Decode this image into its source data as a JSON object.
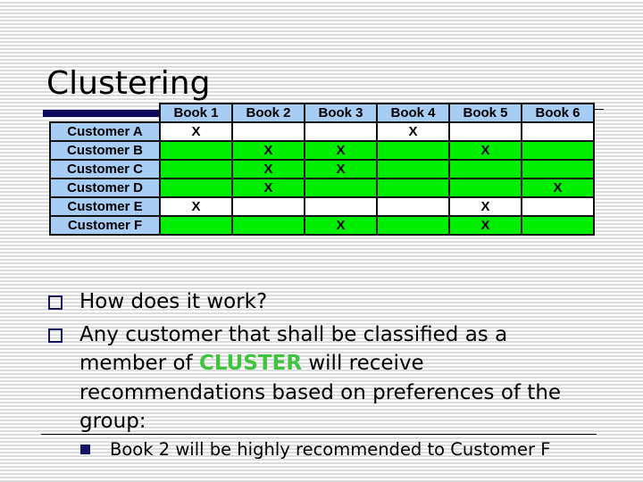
{
  "slide": {
    "title": "Clustering"
  },
  "table": {
    "columns": [
      "Book 1",
      "Book 2",
      "Book 3",
      "Book 4",
      "Book 5",
      "Book 6"
    ],
    "rows": [
      {
        "label": "Customer A",
        "cells": [
          "X",
          "",
          "",
          "X",
          "",
          ""
        ],
        "highlight": false
      },
      {
        "label": "Customer B",
        "cells": [
          "",
          "X",
          "X",
          "",
          "X",
          ""
        ],
        "highlight": true
      },
      {
        "label": "Customer C",
        "cells": [
          "",
          "X",
          "X",
          "",
          "",
          ""
        ],
        "highlight": true
      },
      {
        "label": "Customer D",
        "cells": [
          "",
          "X",
          "",
          "",
          "",
          "X"
        ],
        "highlight": true
      },
      {
        "label": "Customer E",
        "cells": [
          "X",
          "",
          "",
          "",
          "X",
          ""
        ],
        "highlight": false
      },
      {
        "label": "Customer F",
        "cells": [
          "",
          "",
          "X",
          "",
          "X",
          ""
        ],
        "highlight": true
      }
    ],
    "colors": {
      "header_bg": "#a8cdf5",
      "cluster_bg": "#00ee00",
      "other_bg": "#ffffff"
    }
  },
  "bullets": [
    {
      "text": "How does it work?"
    },
    {
      "text_before": "Any customer that shall be classified as a member of ",
      "emphasis": "CLUSTER",
      "text_after": " will receive recommendations based on preferences of the group:"
    }
  ],
  "sub_bullets": [
    {
      "text": "Book 2 will be highly recommended to Customer F"
    }
  ],
  "colors": {
    "emphasis": "#3ec43e",
    "bullet": "#141464",
    "title_bar": "#0a0a5a"
  }
}
